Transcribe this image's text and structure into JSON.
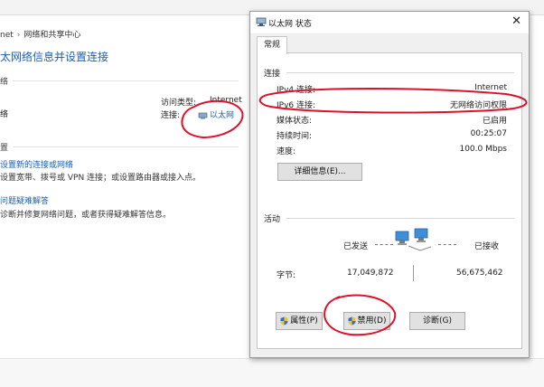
{
  "background": {
    "breadcrumb": [
      "net",
      "网络和共享中心"
    ],
    "title": "太网络信息并设置连接",
    "section_network": "络",
    "network_text": "络",
    "access_type_label": "访问类型:",
    "access_type_value": "Internet",
    "connection_label": "连接:",
    "connection_value": "以太网",
    "section_settings": "置",
    "link_new_connection": "设置新的连接或网络",
    "desc_new_connection": "设置宽带、拨号或 VPN 连接；或设置路由器或接入点。",
    "link_troubleshoot": "问题疑难解答",
    "desc_troubleshoot": "诊断并修复网络问题，或者获得疑难解答信息。"
  },
  "dialog": {
    "title": "以太网 状态",
    "tab": "常规",
    "connection_group": "连接",
    "rows": [
      {
        "label": "IPv4 连接:",
        "value": "Internet"
      },
      {
        "label": "IPv6 连接:",
        "value": "无网络访问权限"
      },
      {
        "label": "媒体状态:",
        "value": "已启用"
      },
      {
        "label": "持续时间:",
        "value": "00:25:07"
      },
      {
        "label": "速度:",
        "value": "100.0 Mbps"
      }
    ],
    "details_button": "详细信息(E)...",
    "activity_group": "活动",
    "sent_label": "已发送",
    "received_label": "已接收",
    "bytes_label": "字节:",
    "bytes_sent": "17,049,872",
    "bytes_received": "56,675,462",
    "properties_button": "属性(P)",
    "disable_button": "禁用(D)",
    "diagnose_button": "诊断(G)"
  },
  "colors": {
    "link": "#1a5fb4",
    "annotation": "#e0102a"
  }
}
